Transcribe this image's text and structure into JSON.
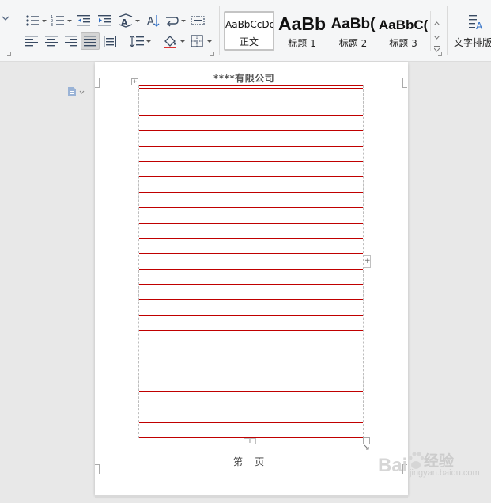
{
  "ribbon": {
    "styles": [
      {
        "preview": "AaBbCcDd",
        "label": "正文",
        "selected": true
      },
      {
        "preview": "AaBb",
        "label": "标题 1"
      },
      {
        "preview": "AaBb(",
        "label": "标题 2"
      },
      {
        "preview": "AaBbC(",
        "label": "标题 3"
      }
    ],
    "text_layout_label": "文字排版",
    "icons": {
      "bullets": "bullet-list-icon",
      "numbering": "numbered-list-icon",
      "decrease_indent": "decrease-indent-icon",
      "increase_indent": "increase-indent-icon",
      "chinese_layout": "chinese-layout-icon",
      "sort": "sort-icon",
      "show_marks": "paragraph-marks-icon",
      "align_left": "align-left-icon",
      "align_center": "align-center-icon",
      "align_right": "align-right-icon",
      "align_justify": "align-justify-icon",
      "distributed": "distributed-align-icon",
      "line_spacing": "line-spacing-icon",
      "shading": "shading-icon",
      "borders": "borders-icon",
      "text_layout": "text-layout-icon"
    }
  },
  "document": {
    "header_text": "****有限公司",
    "footer_text": "第    页",
    "table_row_count": 23,
    "line_color": "#c00000"
  },
  "watermark": {
    "text": "经验",
    "url": "jingyan.baidu.com"
  }
}
